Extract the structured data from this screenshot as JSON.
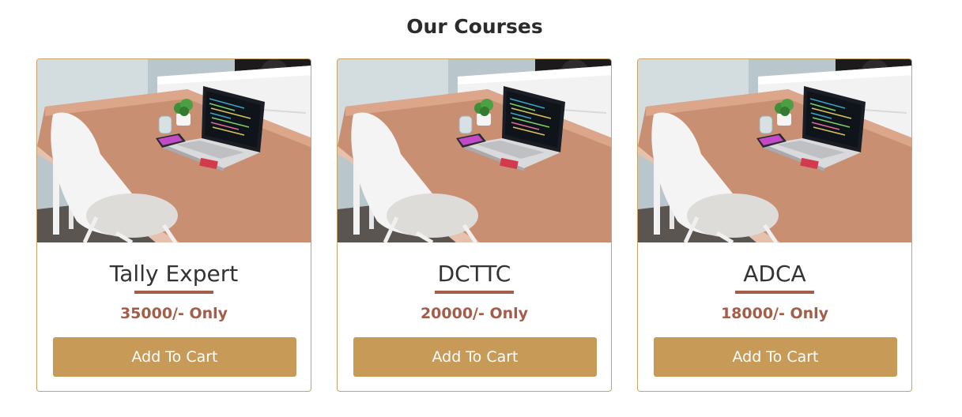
{
  "section": {
    "heading": "Our Courses"
  },
  "courses": [
    {
      "name": "Tally Expert",
      "price": "35000/- Only",
      "button_label": "Add To Cart"
    },
    {
      "name": "DCTTC",
      "price": "20000/- Only",
      "button_label": "Add To Cart"
    },
    {
      "name": "ADCA",
      "price": "18000/- Only",
      "button_label": "Add To Cart"
    }
  ],
  "colors": {
    "accent_button": "#c79a58",
    "price_text": "#a35d48",
    "underline": "#a35d48",
    "card_border": "#c9a26a",
    "heading_text": "#2b2b2b"
  },
  "icons": {
    "course_image": "desk-laptop-photo"
  }
}
